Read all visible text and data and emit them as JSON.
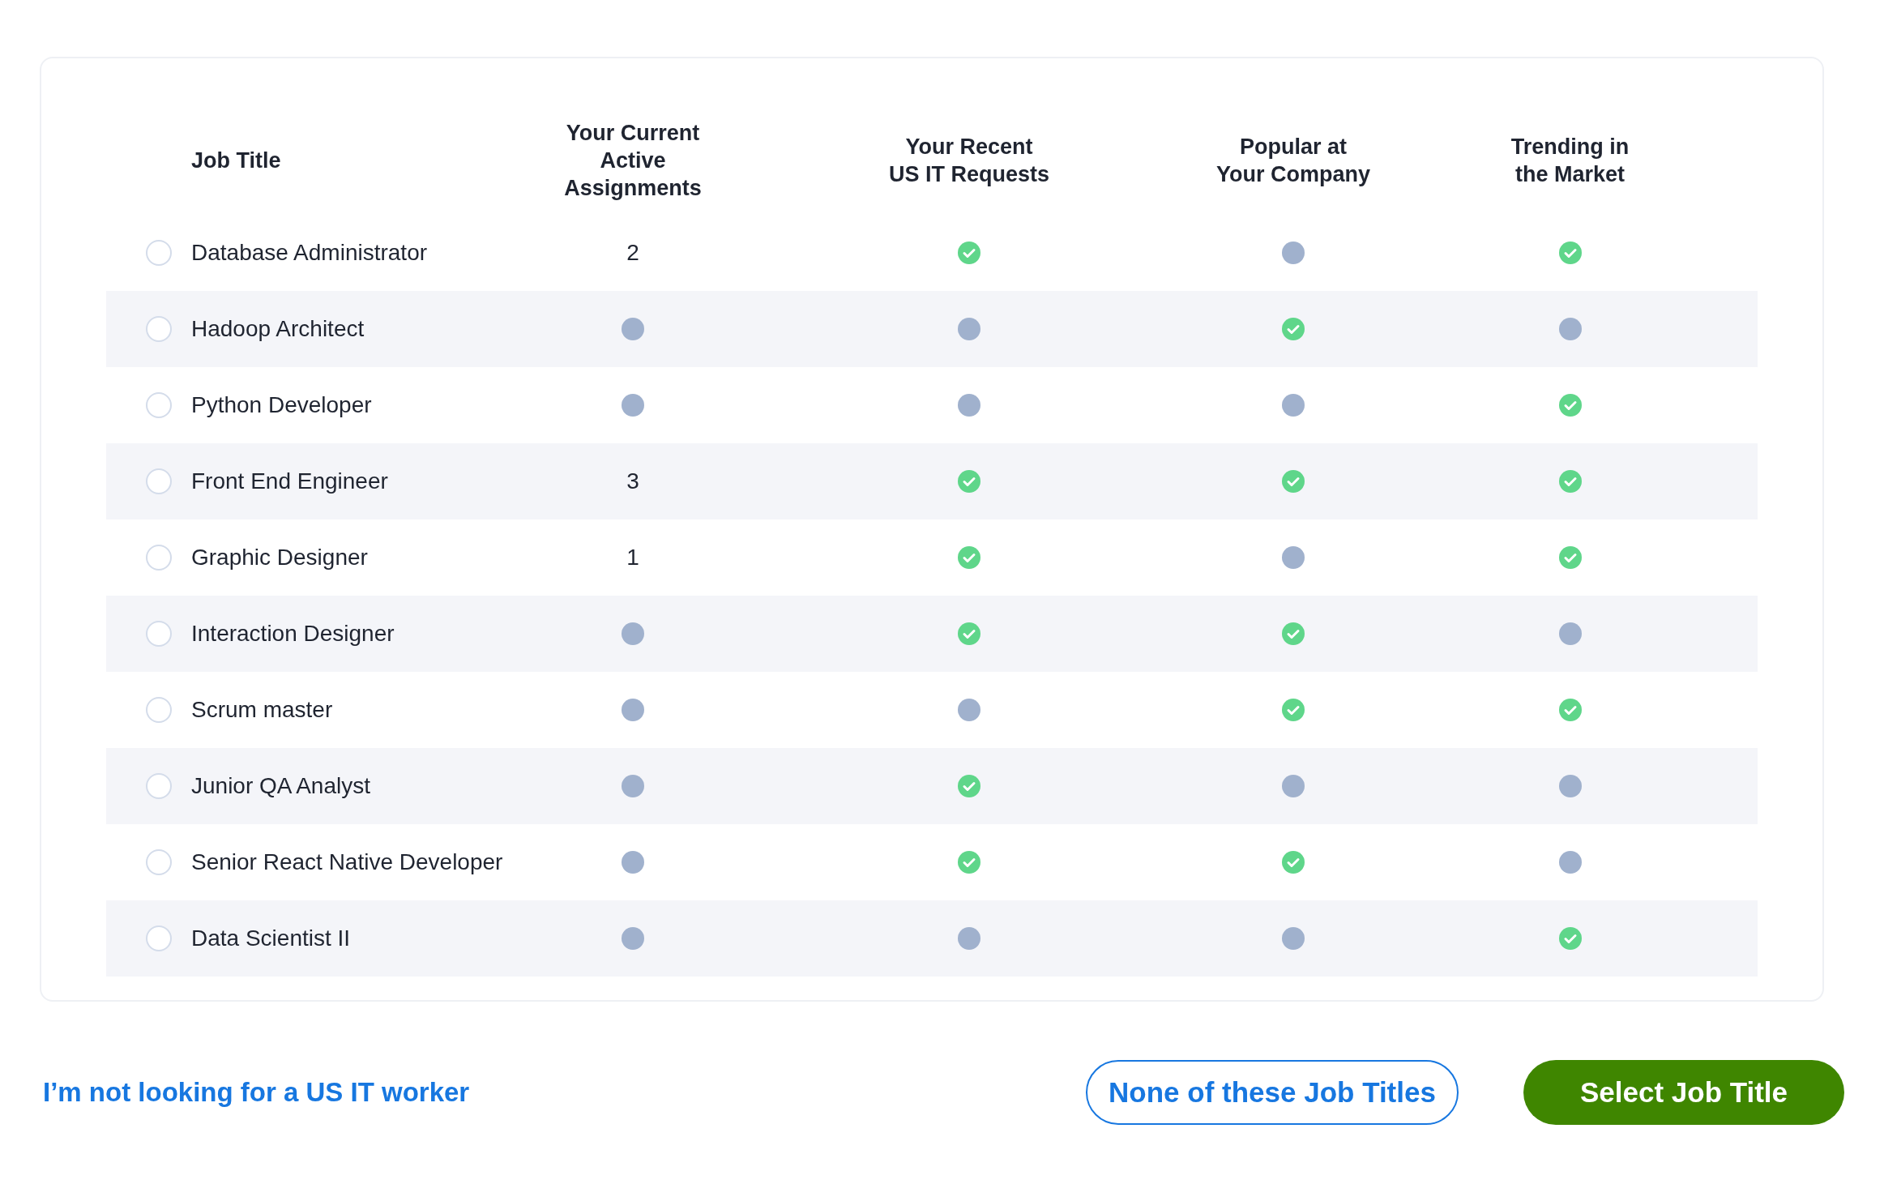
{
  "table": {
    "columns": [
      {
        "lines": [
          "Job Title"
        ]
      },
      {
        "lines": [
          "Your Current",
          "Active Assignments"
        ]
      },
      {
        "lines": [
          "Your Recent",
          "US IT Requests"
        ]
      },
      {
        "lines": [
          "Popular at",
          "Your Company"
        ]
      },
      {
        "lines": [
          "Trending in",
          "the Market"
        ]
      }
    ],
    "rows": [
      {
        "title": "Database Administrator",
        "selected": false,
        "cells": [
          {
            "kind": "count",
            "text": "2"
          },
          {
            "kind": "status",
            "met": true
          },
          {
            "kind": "status",
            "met": false
          },
          {
            "kind": "status",
            "met": true
          }
        ]
      },
      {
        "title": "Hadoop Architect",
        "selected": false,
        "cells": [
          {
            "kind": "status",
            "met": false
          },
          {
            "kind": "status",
            "met": false
          },
          {
            "kind": "status",
            "met": true
          },
          {
            "kind": "status",
            "met": false
          }
        ]
      },
      {
        "title": "Python Developer",
        "selected": false,
        "cells": [
          {
            "kind": "status",
            "met": false
          },
          {
            "kind": "status",
            "met": false
          },
          {
            "kind": "status",
            "met": false
          },
          {
            "kind": "status",
            "met": true
          }
        ]
      },
      {
        "title": "Front End Engineer",
        "selected": false,
        "cells": [
          {
            "kind": "count",
            "text": "3"
          },
          {
            "kind": "status",
            "met": true
          },
          {
            "kind": "status",
            "met": true
          },
          {
            "kind": "status",
            "met": true
          }
        ]
      },
      {
        "title": "Graphic Designer",
        "selected": false,
        "cells": [
          {
            "kind": "count",
            "text": "1"
          },
          {
            "kind": "status",
            "met": true
          },
          {
            "kind": "status",
            "met": false
          },
          {
            "kind": "status",
            "met": true
          }
        ]
      },
      {
        "title": "Interaction Designer",
        "selected": false,
        "cells": [
          {
            "kind": "status",
            "met": false
          },
          {
            "kind": "status",
            "met": true
          },
          {
            "kind": "status",
            "met": true
          },
          {
            "kind": "status",
            "met": false
          }
        ]
      },
      {
        "title": "Scrum master",
        "selected": false,
        "cells": [
          {
            "kind": "status",
            "met": false
          },
          {
            "kind": "status",
            "met": false
          },
          {
            "kind": "status",
            "met": true
          },
          {
            "kind": "status",
            "met": true
          }
        ]
      },
      {
        "title": "Junior QA Analyst",
        "selected": false,
        "cells": [
          {
            "kind": "status",
            "met": false
          },
          {
            "kind": "status",
            "met": true
          },
          {
            "kind": "status",
            "met": false
          },
          {
            "kind": "status",
            "met": false
          }
        ]
      },
      {
        "title": "Senior React Native Developer",
        "selected": false,
        "cells": [
          {
            "kind": "status",
            "met": false
          },
          {
            "kind": "status",
            "met": true
          },
          {
            "kind": "status",
            "met": true
          },
          {
            "kind": "status",
            "met": false
          }
        ]
      },
      {
        "title": "Data Scientist II",
        "selected": false,
        "cells": [
          {
            "kind": "status",
            "met": false
          },
          {
            "kind": "status",
            "met": false
          },
          {
            "kind": "status",
            "met": false
          },
          {
            "kind": "status",
            "met": true
          }
        ]
      }
    ]
  },
  "footer": {
    "link": "I’m not looking for a US IT worker",
    "secondary_button": "None of these Job Titles",
    "primary_button": "Select Job Title"
  }
}
